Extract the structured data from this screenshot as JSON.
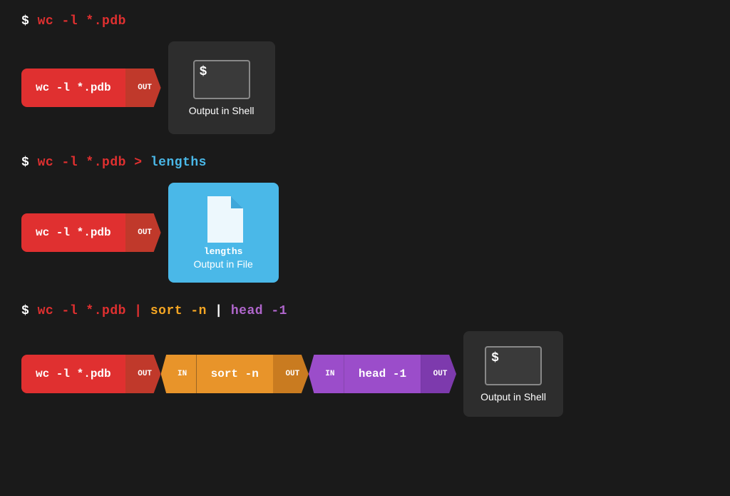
{
  "sections": [
    {
      "id": "section1",
      "command": {
        "dollar": "$ ",
        "text": "wc -l *.pdb",
        "color": "red"
      },
      "pipeline": [
        {
          "type": "cmd",
          "label": "wc -l *.pdb",
          "color": "red"
        },
        {
          "type": "arrow-out",
          "label": "OUT",
          "color": "red"
        },
        {
          "type": "shell",
          "label": "Output in Shell"
        }
      ]
    },
    {
      "id": "section2",
      "command": {
        "dollar": "$ ",
        "text1": "wc -l *.pdb > ",
        "text2": "lengths",
        "text1color": "red",
        "text2color": "blue"
      },
      "pipeline": [
        {
          "type": "cmd",
          "label": "wc -l *.pdb",
          "color": "red"
        },
        {
          "type": "arrow-out",
          "label": "OUT",
          "color": "red"
        },
        {
          "type": "file",
          "filename": "lengths",
          "label": "Output in File"
        }
      ]
    },
    {
      "id": "section3",
      "command": {
        "dollar": "$ ",
        "text1": "wc -l *.pdb | ",
        "text2": "sort -n",
        "text3": " | ",
        "text4": "head -1",
        "text1color": "red",
        "text2color": "orange",
        "text3color": "white",
        "text4color": "purple"
      },
      "pipeline": [
        {
          "type": "cmd",
          "label": "wc -l *.pdb",
          "color": "red"
        },
        {
          "type": "arrow-out",
          "label": "OUT",
          "color": "red"
        },
        {
          "type": "in-notch",
          "label": "IN",
          "color": "orange"
        },
        {
          "type": "cmd-mid",
          "label": "sort -n",
          "color": "orange"
        },
        {
          "type": "arrow-out",
          "label": "OUT",
          "color": "orange"
        },
        {
          "type": "in-notch",
          "label": "IN",
          "color": "purple"
        },
        {
          "type": "cmd-mid",
          "label": "head -1",
          "color": "purple"
        },
        {
          "type": "arrow-out",
          "label": "OUT",
          "color": "purple"
        },
        {
          "type": "shell",
          "label": "Output in Shell"
        }
      ]
    }
  ],
  "labels": {
    "out": "OUT",
    "in": "IN",
    "output_in_shell": "Output in Shell",
    "output_in_file": "Output in File",
    "file_icon_label": "lengths",
    "dollar_sign": "$"
  }
}
